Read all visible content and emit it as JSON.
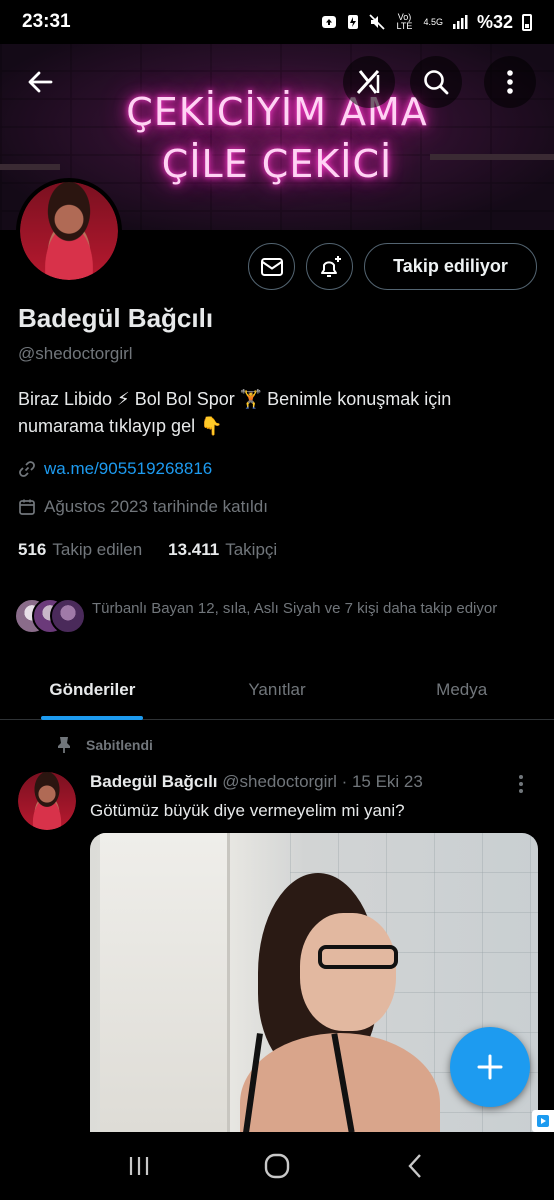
{
  "status_bar": {
    "time": "23:31",
    "network_label": "Vo) LTE",
    "network_speed": "4.5G",
    "battery_percent": "%32"
  },
  "banner": {
    "line1": "ÇEKİCİYİM AMA",
    "line2": "ÇİLE ÇEKİCİ",
    "glow_color": "#ff2bc2"
  },
  "profile": {
    "name": "Badegül Bağcılı",
    "handle": "@shedoctorgirl",
    "bio": "Biraz Libido ⚡ Bol Bol Spor 🏋 Benimle konuşmak için numarama tıklayıp gel 👇",
    "link": "wa.me/905519268816",
    "joined": "Ağustos 2023 tarihinde katıldı",
    "following_count": "516",
    "following_label": "Takip edilen",
    "followers_count": "13.411",
    "followers_label": "Takipçi",
    "followed_by": "Türbanlı Bayan 12, sıla, Aslı Siyah ve 7 kişi daha takip ediyor",
    "follow_button": "Takip ediliyor"
  },
  "tabs": [
    {
      "label": "Gönderiler",
      "active": true
    },
    {
      "label": "Yanıtlar",
      "active": false
    },
    {
      "label": "Medya",
      "active": false
    }
  ],
  "pinned_tweet": {
    "pinned_label": "Sabitlendi",
    "author": "Badegül Bağcılı",
    "handle_date": "@shedoctorgirl · 15 Eki 23",
    "text": "Götümüz büyük diye vermeyelim mi yani?"
  },
  "colors": {
    "accent": "#1d9bf0",
    "background": "#000000",
    "muted": "#71767b",
    "border": "#536471"
  },
  "icons": {
    "back": "arrow-left-icon",
    "grok": "grok-icon",
    "search": "search-icon",
    "more": "more-vertical-icon",
    "message": "envelope-icon",
    "notify": "bell-plus-icon",
    "link": "link-icon",
    "calendar": "calendar-icon",
    "pin": "pin-icon",
    "compose": "plus-icon"
  }
}
